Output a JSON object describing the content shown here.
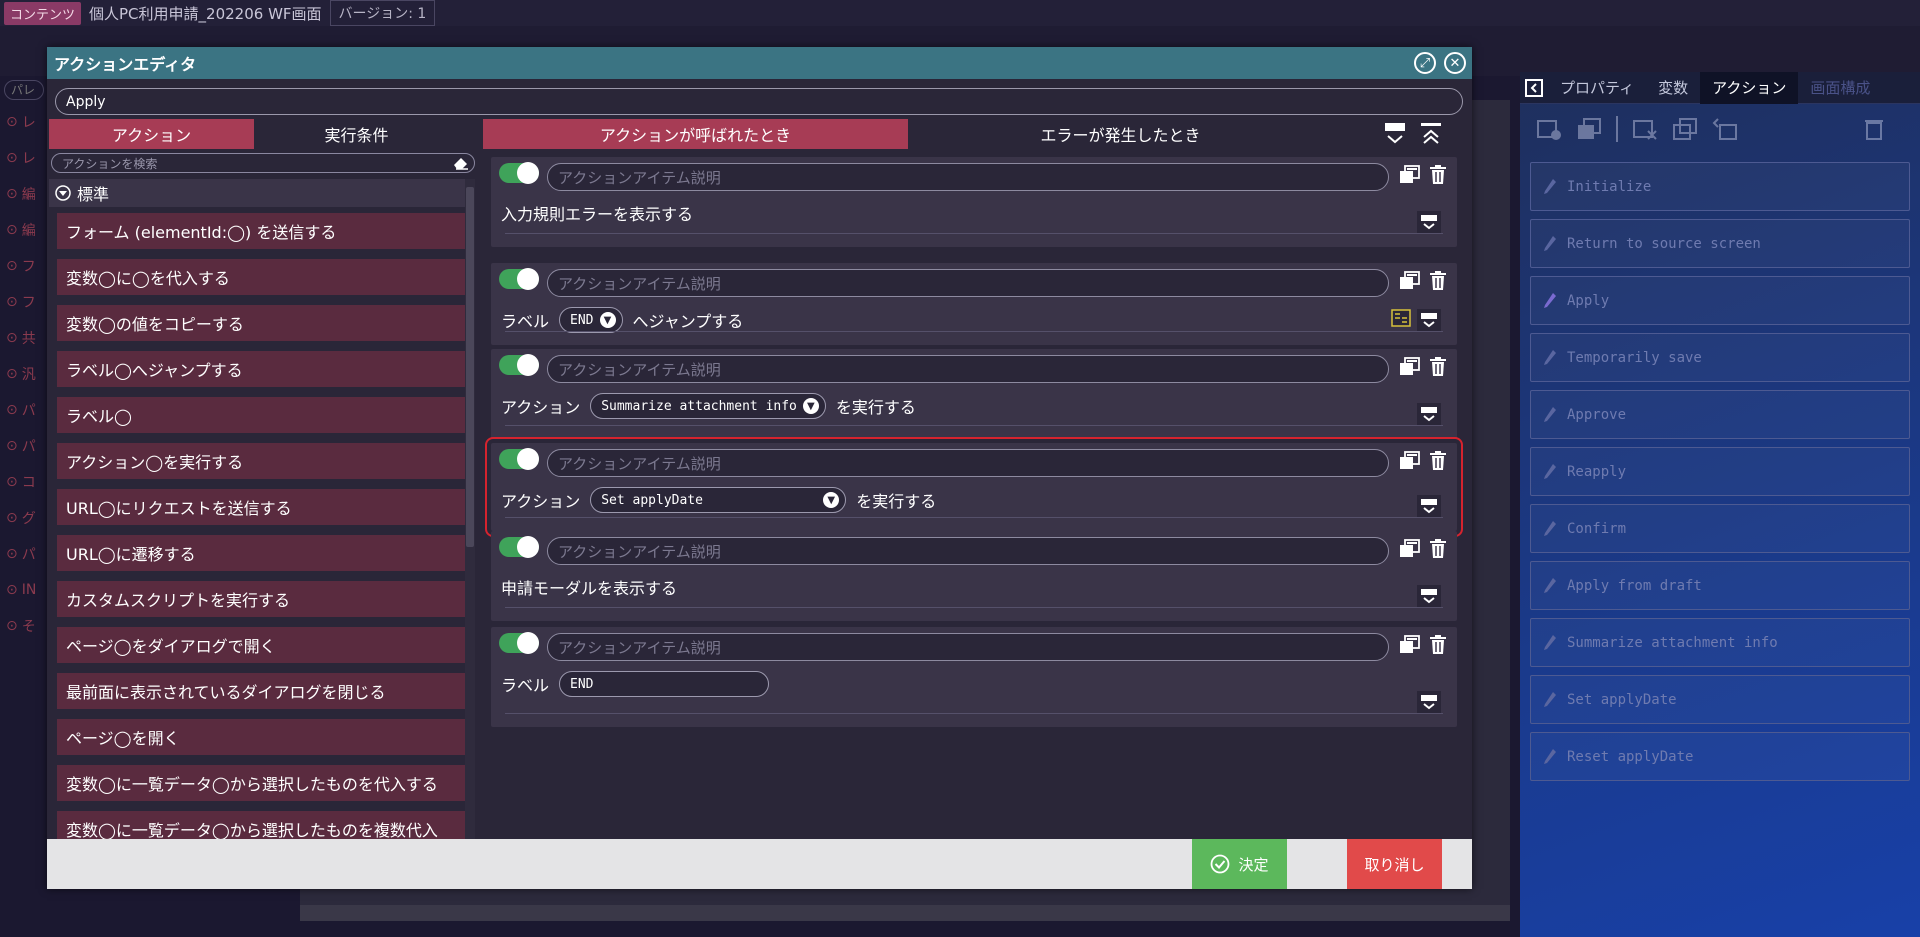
{
  "app": {
    "contents_tag": "コンテンツ",
    "screen_title": "個人PC利用申請_202206 WF画面",
    "version_label": "バージョン: 1"
  },
  "background_left_palette": {
    "search_placeholder": "パレ",
    "rows": [
      "レ",
      "レ",
      "編",
      "編",
      "フ",
      "フ",
      "共",
      "汎",
      "パ",
      "パ",
      "コ",
      "グ",
      "パ",
      "IN",
      "そ"
    ]
  },
  "right_panel": {
    "tabs": [
      "プロパティ",
      "変数",
      "アクション",
      "画面構成"
    ],
    "active_tab": "アクション",
    "actions": [
      "Initialize",
      "Return to source screen",
      "Apply",
      "Temporarily save",
      "Approve",
      "Reapply",
      "Confirm",
      "Apply from draft",
      "Summarize attachment info",
      "Set applyDate",
      "Reset applyDate"
    ]
  },
  "modal": {
    "title": "アクションエディタ",
    "action_name": "Apply",
    "left_tabs": [
      "アクション",
      "実行条件"
    ],
    "search_placeholder": "アクションを検索",
    "group_label": "標準",
    "palette_items": [
      "フォーム (elementId:◯) を送信する",
      "変数◯に◯を代入する",
      "変数◯の値をコピーする",
      "ラベル◯へジャンプする",
      "ラベル◯",
      "アクション◯を実行する",
      "URL◯にリクエストを送信する",
      "URL◯に遷移する",
      "カスタムスクリプトを実行する",
      "ページ◯をダイアログで開く",
      "最前面に表示されているダイアログを閉じる",
      "ページ◯を開く",
      "変数◯に一覧データ◯から選択したものを代入する",
      "変数◯に一覧データ◯から選択したものを複数代入"
    ],
    "event_tabs": [
      "アクションが呼ばれたとき",
      "エラーが発生したとき"
    ],
    "description_placeholder": "アクションアイテム説明",
    "items": [
      {
        "text": "入力規則エラーを表示する"
      },
      {
        "prefix": "ラベル",
        "select": "END",
        "suffix": "へジャンプする"
      },
      {
        "prefix": "アクション",
        "select": "Summarize attachment info",
        "suffix": "を実行する"
      },
      {
        "prefix": "アクション",
        "select": "Set applyDate",
        "suffix": "を実行する"
      },
      {
        "text": "申請モーダルを表示する"
      },
      {
        "prefix": "ラベル",
        "input_value": "END"
      }
    ],
    "ok_label": "決定",
    "cancel_label": "取り消し"
  },
  "colors": {
    "header_teal": "#3b7483",
    "active_tab_red": "#a73c55",
    "toggle_green": "#3fa35a",
    "ok_green": "#5cb85c",
    "cancel_red": "#e14a4a",
    "selection_outline": "#d6232e"
  }
}
